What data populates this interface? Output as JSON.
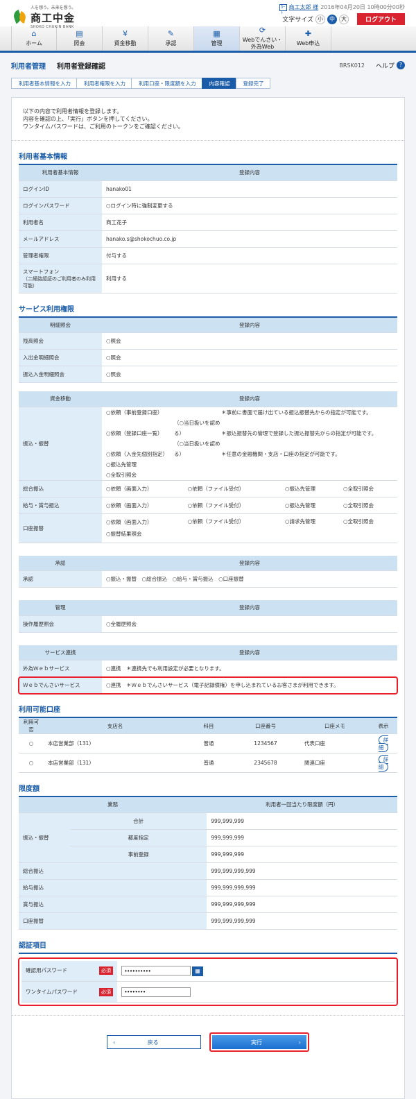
{
  "header": {
    "logo_tagline": "人を想う。未来を想う。",
    "logo_name": "商工中金",
    "logo_en": "SHOKO CHUKIN BANK",
    "user_name": "商工太郎 様",
    "login_time": "2016年04月20日 10時00分00秒",
    "font_size_label": "文字サイズ",
    "font_sizes": [
      "小",
      "中",
      "大"
    ],
    "logout_label": "ログアウト"
  },
  "nav": [
    {
      "label": "ホーム",
      "icon": "home-icon",
      "glyph": "⌂"
    },
    {
      "label": "照会",
      "icon": "document-icon",
      "glyph": "▤"
    },
    {
      "label": "資金移動",
      "icon": "transfer-icon",
      "glyph": "¥"
    },
    {
      "label": "承認",
      "icon": "approve-icon",
      "glyph": "✎"
    },
    {
      "label": "管理",
      "icon": "manage-icon",
      "glyph": "▦"
    },
    {
      "label": "Webでんさい・",
      "label2": "外為Web",
      "icon": "web-icon",
      "glyph": "⟳"
    },
    {
      "label": "Web申込",
      "icon": "apply-icon",
      "glyph": "✚"
    }
  ],
  "title": {
    "section": "利用者管理",
    "page": "利用者登録確認",
    "screen_id": "BRSK012",
    "help": "ヘルプ"
  },
  "steps": [
    "利用者基本情報を入力",
    "利用者権限を入力",
    "利用口座・限度額を入力",
    "内容確認",
    "登録完了"
  ],
  "intro": [
    "以下の内容で利用者情報を登録します。",
    "内容を確認の上、「実行」ボタンを押してください。",
    "ワンタイムパスワードは、ご利用のトークンをご確認ください。"
  ],
  "basic": {
    "title": "利用者基本情報",
    "head_key": "利用者基本情報",
    "head_val": "登録内容",
    "rows": [
      {
        "k": "ログインID",
        "v": "hanako01"
      },
      {
        "k": "ログインパスワード",
        "v": "○ログイン時に強制変更する"
      },
      {
        "k": "利用者名",
        "v": "商工花子"
      },
      {
        "k": "メールアドレス",
        "v": "hanako.s@shokochuo.co.jp"
      },
      {
        "k": "管理者権限",
        "v": "付与する"
      },
      {
        "k": "スマートフォン",
        "k2": "（二経路認証のご利用者のみ利用可能）",
        "v": "利用する"
      }
    ]
  },
  "service": {
    "title": "サービス利用権限",
    "head_val": "登録内容",
    "inquiry": {
      "head": "明細照会",
      "rows": [
        {
          "k": "残高照会",
          "v": "○照会"
        },
        {
          "k": "入出金明細照会",
          "v": "○照会"
        },
        {
          "k": "振込入金明細照会",
          "v": "○照会"
        }
      ]
    },
    "funds": {
      "head": "資金移動",
      "transfer_key": "振込・振替",
      "transfer_lines": [
        {
          "a": "○依頼（事前登録口座）",
          "b": "",
          "c": "＊事前に書面で届け出ている振込振替先からの指定が可能です。"
        },
        {
          "a": "○依頼（登録口座一覧）",
          "b": "（○当日扱いを認める）",
          "c": "＊振込振替先の管理で登録した振込振替先からの指定が可能です。"
        },
        {
          "a": "○依頼（入金先個別指定）",
          "b": "（○当日扱いを認める）",
          "c": "＊任意の金融機関・支店・口座の指定が可能です。"
        },
        {
          "a": "○振込先管理",
          "b": "",
          "c": ""
        },
        {
          "a": "○全取引照会",
          "b": "",
          "c": ""
        }
      ],
      "rows": [
        {
          "k": "総合振込",
          "cols": [
            "○依頼（画面入力）",
            "○依頼（ファイル受付）",
            "○振込先管理",
            "○全取引照会"
          ]
        },
        {
          "k": "給与・賞与振込",
          "cols": [
            "○依頼（画面入力）",
            "○依頼（ファイル受付）",
            "○振込先管理",
            "○全取引照会"
          ]
        },
        {
          "k": "口座振替",
          "cols": [
            "○依頼（画面入力）",
            "○依頼（ファイル受付）",
            "○請求先管理",
            "○全取引照会"
          ],
          "extra": "○振替結果照会"
        }
      ]
    },
    "approval": {
      "head": "承認",
      "k": "承認",
      "v": "○振込・振替　○総合振込　○給与・賞与振込　○口座振替"
    },
    "manage": {
      "head": "管理",
      "k": "操作履歴照会",
      "v": "○全履歴照会"
    },
    "link": {
      "head": "サービス連携",
      "rows": [
        {
          "k": "外為Ｗｅｂサービス",
          "v": "○連携　＊連携先でも利用設定が必要となります。"
        },
        {
          "k": "Ｗｅｂでんさいサービス",
          "v": "○連携　＊Ｗｅｂでんさいサービス（電子記録債権）を申し込まれているお客さまが利用できます。"
        }
      ]
    }
  },
  "accounts": {
    "title": "利用可能口座",
    "headers": [
      "利用可否",
      "支店名",
      "科目",
      "口座番号",
      "口座メモ",
      "表示"
    ],
    "rows": [
      {
        "avail": "○",
        "branch": "本店営業部（131）",
        "type": "普通",
        "number": "1234567",
        "memo": "代表口座",
        "btn": "詳細"
      },
      {
        "avail": "○",
        "branch": "本店営業部（131）",
        "type": "普通",
        "number": "2345678",
        "memo": "関連口座",
        "btn": "詳細"
      }
    ]
  },
  "limits": {
    "title": "限度額",
    "head_key": "業務",
    "head_val": "利用者一回当たり限度額（円）",
    "transfer_key": "振込・振替",
    "sub": [
      {
        "k": "合計",
        "v": "999,999,999"
      },
      {
        "k": "都度指定",
        "v": "999,999,999"
      },
      {
        "k": "事前登録",
        "v": "999,999,999"
      }
    ],
    "rows": [
      {
        "k": "総合振込",
        "v": "999,999,999,999"
      },
      {
        "k": "給与振込",
        "v": "999,999,999,999"
      },
      {
        "k": "賞与振込",
        "v": "999,999,999,999"
      },
      {
        "k": "口座振替",
        "v": "999,999,999,999"
      }
    ]
  },
  "auth": {
    "title": "認証項目",
    "required": "必須",
    "confirm_label": "確認用パスワード",
    "confirm_value": "••••••••••",
    "otp_label": "ワンタイムパスワード",
    "otp_value": "••••••••"
  },
  "buttons": {
    "back": "戻る",
    "exec": "実行"
  },
  "colors": {
    "primary": "#1a5ca8",
    "accent_red": "#d9232e",
    "header_cell": "#cce2f3"
  }
}
